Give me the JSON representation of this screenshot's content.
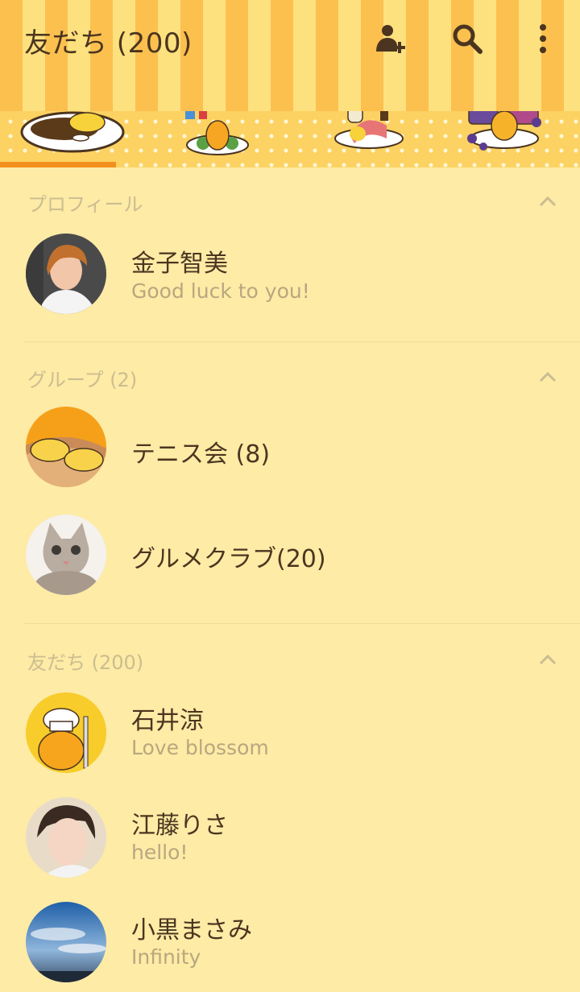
{
  "header": {
    "title": "友だち (200)",
    "icons": [
      "add-friend-icon",
      "search-icon",
      "more-vert-icon"
    ]
  },
  "tabs": [
    {
      "name": "curry-rice-tab",
      "selected": true
    },
    {
      "name": "salad-tab",
      "selected": false
    },
    {
      "name": "bacon-tab",
      "selected": false
    },
    {
      "name": "jam-tab",
      "selected": false
    }
  ],
  "sections": {
    "profile": {
      "title": "プロフィール",
      "items": [
        {
          "name": "金子智美",
          "status": "Good luck to you!"
        }
      ]
    },
    "groups": {
      "title": "グループ (2)",
      "items": [
        {
          "name": "テニス会 (8)"
        },
        {
          "name": "グルメクラブ(20)"
        }
      ]
    },
    "friends": {
      "title": "友だち (200)",
      "items": [
        {
          "name": "石井涼",
          "status": "Love blossom"
        },
        {
          "name": "江藤りさ",
          "status": "hello!"
        },
        {
          "name": "小黒まさみ",
          "status": "Infinity"
        }
      ]
    }
  },
  "colors": {
    "background": "#fdeba6",
    "stripe_a": "#fcc04f",
    "stripe_b": "#fde17e",
    "text_primary": "#4b3520",
    "text_secondary": "#b8a77f",
    "section_header": "#cbbd90",
    "tab_indicator": "#f3901d"
  }
}
